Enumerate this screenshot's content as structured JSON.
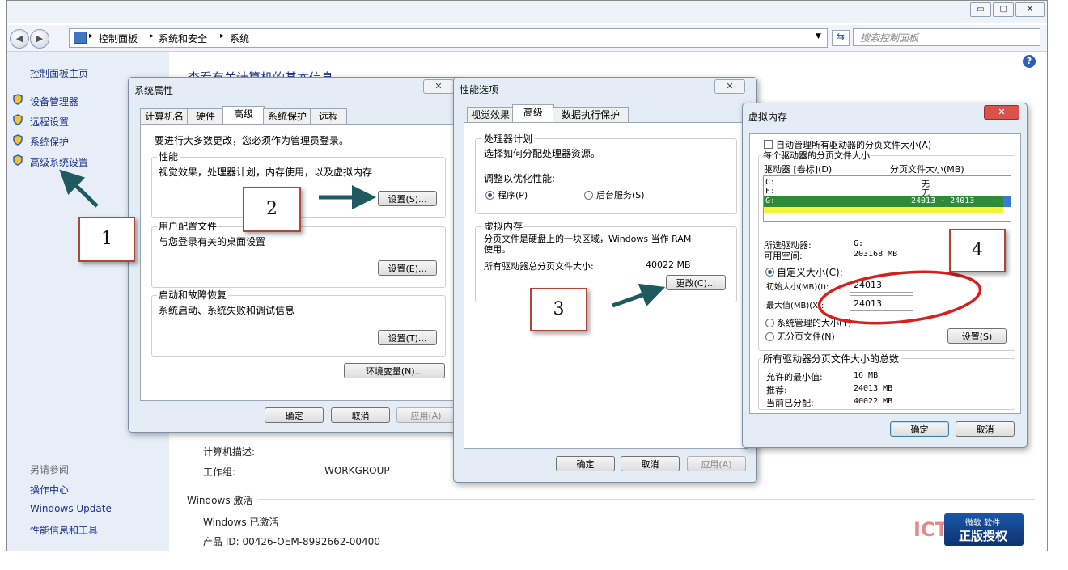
{
  "explorer": {
    "window_buttons": [
      "▭",
      "▢",
      "✕"
    ],
    "breadcrumb": [
      "控制面板",
      "系统和安全",
      "系统"
    ],
    "search_placeholder": "搜索控制面板",
    "help_glyph": "?",
    "sidebar": {
      "home": "控制面板主页",
      "links": [
        "设备管理器",
        "远程设置",
        "系统保护",
        "高级系统设置"
      ],
      "see_also_title": "另请参阅",
      "see_also": [
        "操作中心",
        "Windows Update",
        "性能信息和工具"
      ]
    },
    "main": {
      "heading": "查看有关计算机的基本信息",
      "computer_desc_label": "计算机描述:",
      "workgroup_label": "工作组:",
      "workgroup_value": "WORKGROUP",
      "activation_title": "Windows 激活",
      "activation_status": "Windows 已激活",
      "product_id": "产品 ID: 00426-OEM-8992662-00400",
      "watermark": "ICT",
      "genuine_badge_top": "微软 软件",
      "genuine_badge_bottom": "正版授权"
    }
  },
  "sysprops": {
    "title": "系统属性",
    "close_glyph": "✕",
    "tabs": [
      "计算机名",
      "硬件",
      "高级",
      "系统保护",
      "远程"
    ],
    "admin_note": "要进行大多数更改，您必须作为管理员登录。",
    "performance": {
      "legend": "性能",
      "desc": "视觉效果，处理器计划，内存使用，以及虚拟内存",
      "button": "设置(S)..."
    },
    "profiles": {
      "legend": "用户配置文件",
      "desc": "与您登录有关的桌面设置",
      "button": "设置(E)..."
    },
    "startup": {
      "legend": "启动和故障恢复",
      "desc": "系统启动、系统失败和调试信息",
      "button": "设置(T)..."
    },
    "env_button": "环境变量(N)...",
    "ok": "确定",
    "cancel": "取消",
    "apply": "应用(A)"
  },
  "perfopts": {
    "title": "性能选项",
    "close_glyph": "✕",
    "tabs": [
      "视觉效果",
      "高级",
      "数据执行保护"
    ],
    "cpu_legend": "处理器计划",
    "cpu_desc": "选择如何分配处理器资源。",
    "optimize_label": "调整以优化性能:",
    "opt_programs": "程序(P)",
    "opt_services": "后台服务(S)",
    "vm_legend": "虚拟内存",
    "vm_desc": "分页文件是硬盘上的一块区域，Windows 当作 RAM 使用。",
    "vm_total_label": "所有驱动器总分页文件大小:",
    "vm_total_value": "40022 MB",
    "change_button": "更改(C)...",
    "ok": "确定",
    "cancel": "取消",
    "apply": "应用(A)"
  },
  "vmem": {
    "title": "虚拟内存",
    "close_glyph": "✕",
    "auto_manage": "自动管理所有驱动器的分页文件大小(A)",
    "per_drive_legend": "每个驱动器的分页文件大小",
    "col_drive": "驱动器 [卷标](D)",
    "col_size": "分页文件大小(MB)",
    "drives": [
      {
        "drive": "C:",
        "size": "无"
      },
      {
        "drive": "F:",
        "size": "无"
      },
      {
        "drive": "G:",
        "size": "24013 - 24013"
      }
    ],
    "selected_drive_label": "所选驱动器:",
    "selected_drive_value": "G:",
    "free_space_label": "可用空间:",
    "free_space_value": "203168 MB",
    "custom_size": "自定义大小(C):",
    "initial_label": "初始大小(MB)(I):",
    "initial_value": "24013",
    "max_label": "最大值(MB)(X):",
    "max_value": "24013",
    "system_managed": "系统管理的大小(Y)",
    "no_paging": "无分页文件(N)",
    "set_button": "设置(S)",
    "totals_legend": "所有驱动器分页文件大小的总数",
    "min_label": "允许的最小值:",
    "min_value": "16 MB",
    "recommended_label": "推荐:",
    "recommended_value": "24013 MB",
    "allocated_label": "当前已分配:",
    "allocated_value": "40022 MB",
    "ok": "确定",
    "cancel": "取消"
  },
  "annotations": [
    "1",
    "2",
    "3",
    "4"
  ],
  "colors": {
    "arrow": "#1e5a5e",
    "note_border": "#b0463a",
    "ellipse": "#d91e1e",
    "row_selected": "#2e8b3a",
    "row_highlight": "#f7f23a"
  }
}
